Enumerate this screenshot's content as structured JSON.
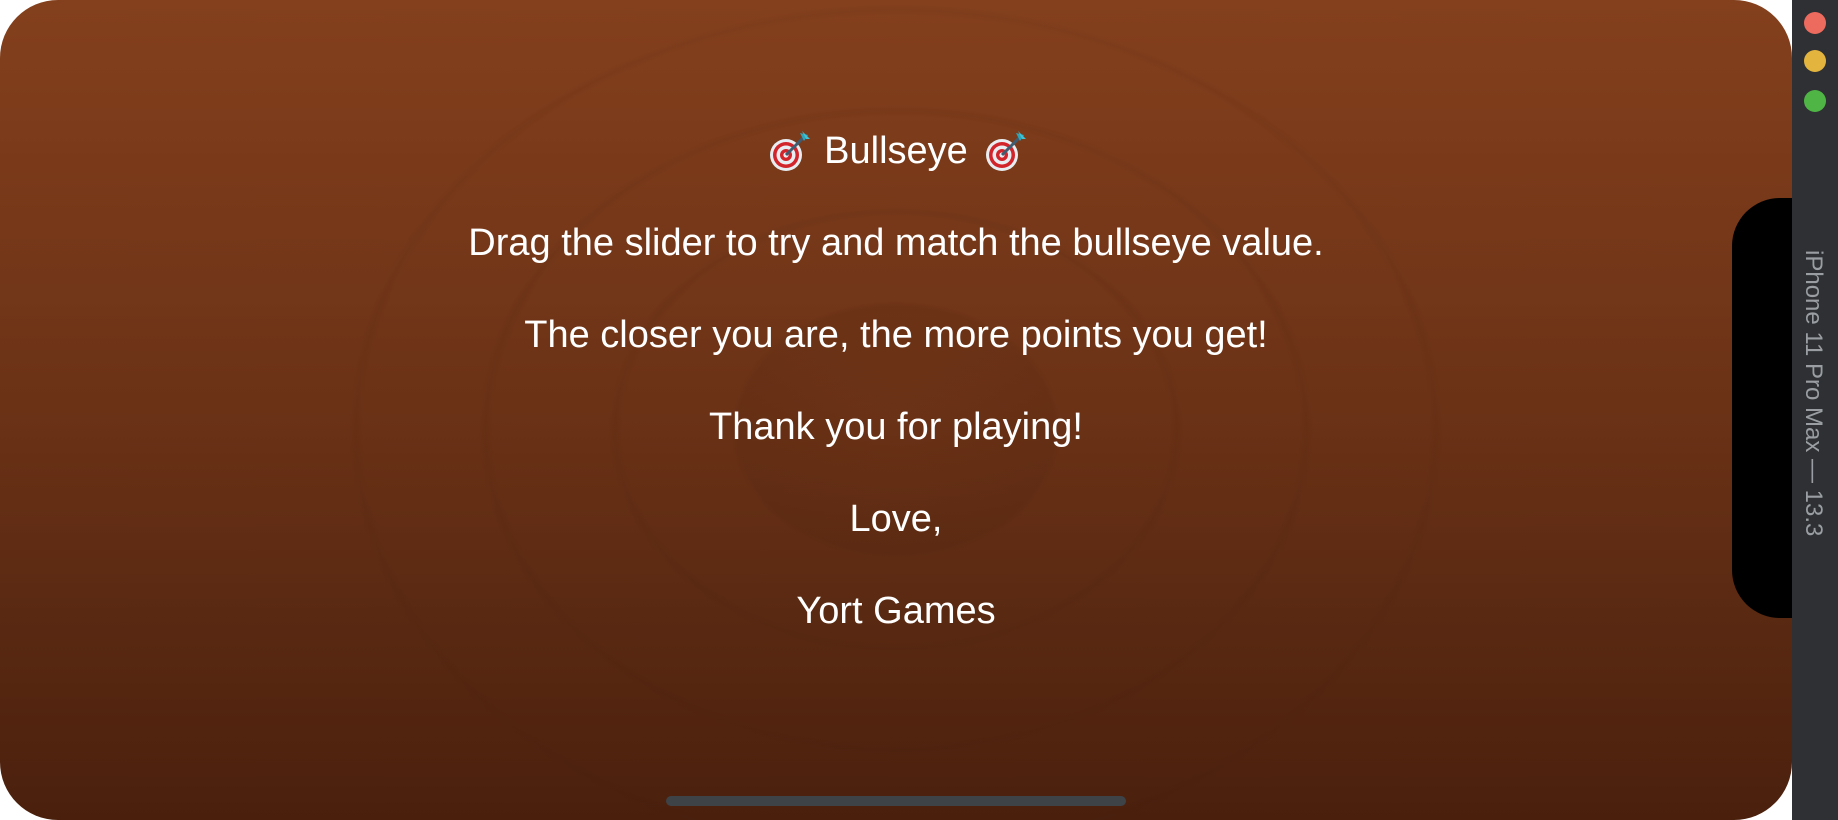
{
  "screen": {
    "title": "Bullseye",
    "title_icon": "dart-target-icon",
    "lines": [
      "Drag the slider to try and match the bullseye value.",
      "The closer you are, the more points you get!",
      "Thank you for playing!",
      "Love,",
      "Yort Games"
    ]
  },
  "simulator": {
    "device_label": "iPhone 11 Pro Max — 13.3"
  },
  "colors": {
    "background": "#7a3a1a",
    "text": "#ffffff",
    "traffic_red": "#ed6a5e",
    "traffic_yellow": "#e3b43e",
    "traffic_green": "#4fb545"
  }
}
